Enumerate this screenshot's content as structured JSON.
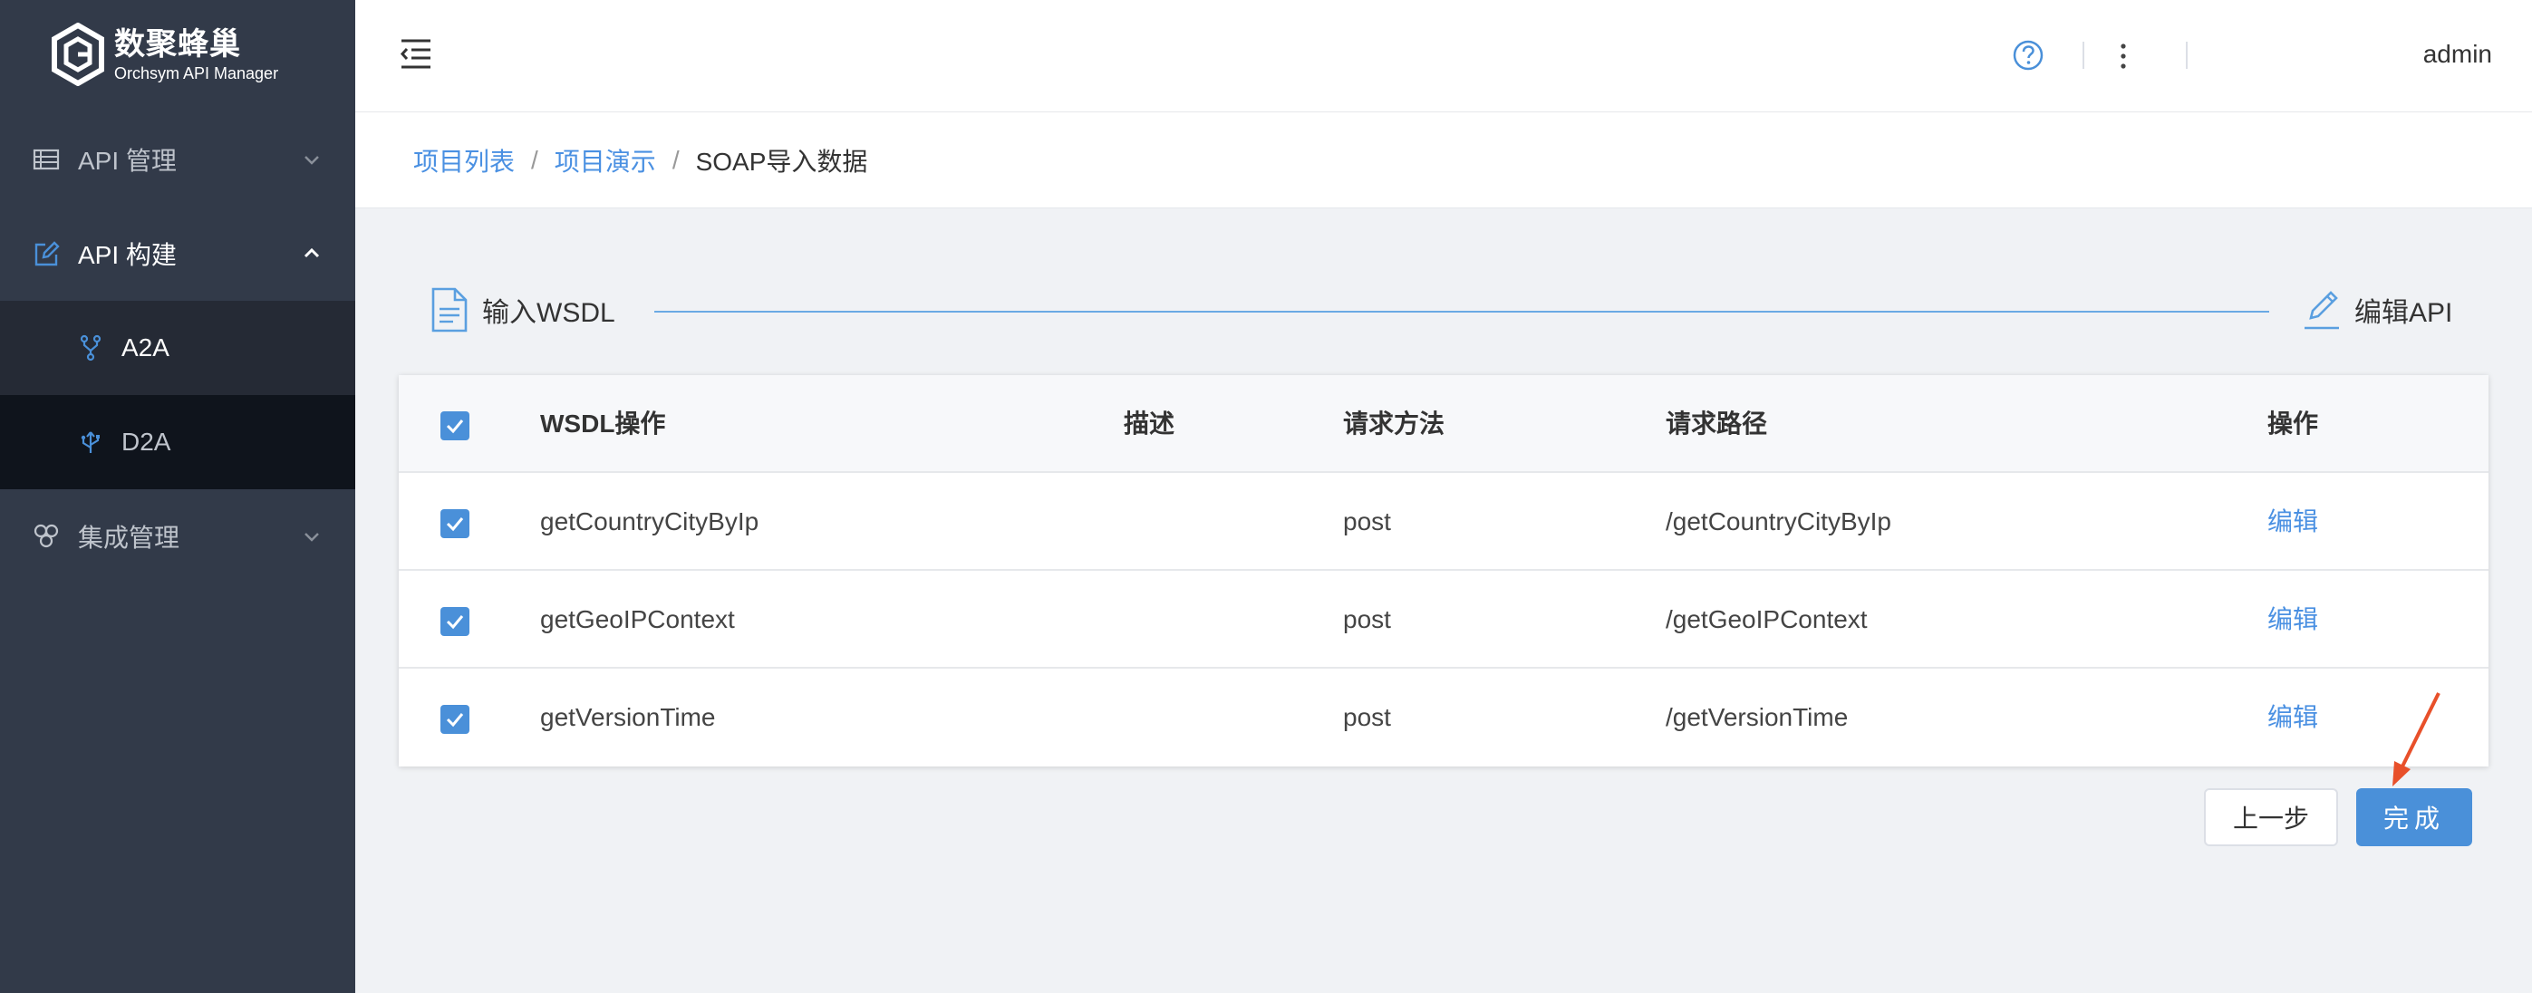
{
  "app": {
    "logo_title": "数聚蜂巢",
    "logo_subtitle": "Orchsym API Manager"
  },
  "sidebar": {
    "items": [
      {
        "label": "API 管理",
        "icon": "table-icon"
      },
      {
        "label": "API 构建",
        "icon": "edit-icon"
      },
      {
        "label": "A2A",
        "icon": "fork-icon"
      },
      {
        "label": "D2A",
        "icon": "usb-icon"
      },
      {
        "label": "集成管理",
        "icon": "cluster-icon"
      }
    ]
  },
  "header": {
    "user": "admin"
  },
  "breadcrumb": {
    "items": [
      "项目列表",
      "项目演示",
      "SOAP导入数据"
    ],
    "separator": "/"
  },
  "steps": {
    "left": "输入WSDL",
    "right": "编辑API"
  },
  "table": {
    "columns": [
      "WSDL操作",
      "描述",
      "请求方法",
      "请求路径",
      "操作"
    ],
    "rows": [
      {
        "operation": "getCountryCityByIp",
        "description": "",
        "method": "post",
        "path": "/getCountryCityByIp",
        "action": "编辑",
        "checked": true
      },
      {
        "operation": "getGeoIPContext",
        "description": "",
        "method": "post",
        "path": "/getGeoIPContext",
        "action": "编辑",
        "checked": true
      },
      {
        "operation": "getVersionTime",
        "description": "",
        "method": "post",
        "path": "/getVersionTime",
        "action": "编辑",
        "checked": true
      }
    ],
    "header_checked": true
  },
  "buttons": {
    "prev": "上一步",
    "finish": "完成"
  },
  "colors": {
    "sidebar_bg": "#323a49",
    "accent": "#4a90d9",
    "link": "#4a90e2",
    "annotation_arrow": "#e8502a"
  }
}
